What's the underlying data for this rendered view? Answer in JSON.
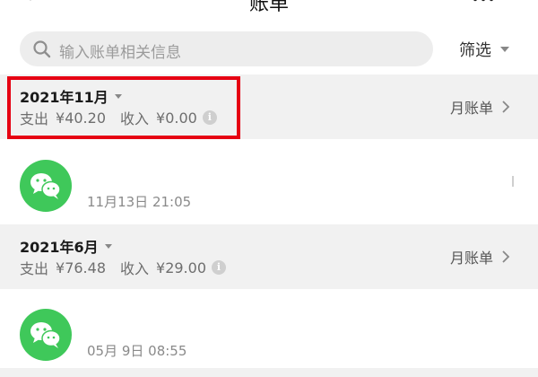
{
  "header": {
    "title": "账单"
  },
  "search": {
    "placeholder": "输入账单相关信息"
  },
  "filter": {
    "label": "筛选"
  },
  "months": [
    {
      "title": "2021年11月",
      "expense_label": "支出",
      "expense": "¥40.20",
      "income_label": "收入",
      "income": "¥0.00",
      "monthly_bill": "月账单",
      "highlighted": true
    },
    {
      "title": "2021年6月",
      "expense_label": "支出",
      "expense": "¥76.48",
      "income_label": "收入",
      "income": "¥29.00",
      "monthly_bill": "月账单",
      "highlighted": false
    }
  ],
  "transactions": [
    {
      "icon": "wechat-icon",
      "time": "11月13日 21:05"
    },
    {
      "icon": "wechat-icon",
      "time": "05月 9日 08:55"
    }
  ],
  "colors": {
    "highlight": "#e60012",
    "wechat": "#3fc85a",
    "header_bg": "#f1f1f1"
  }
}
